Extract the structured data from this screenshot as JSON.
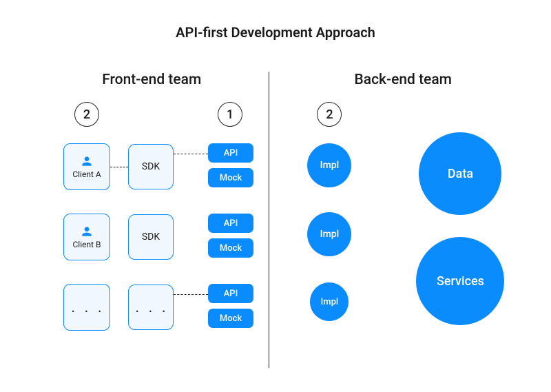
{
  "title": "API-first Development Approach",
  "frontend": {
    "title": "Front-end team",
    "badge_left": "2",
    "badge_right": "1",
    "client_a": "Client A",
    "client_b": "Client B",
    "sdk": "SDK",
    "ellipsis": ". . .",
    "api": "API",
    "mock": "Mock"
  },
  "backend": {
    "title": "Back-end team",
    "badge": "2",
    "impl": "Impl",
    "data": "Data",
    "services": "Services"
  }
}
